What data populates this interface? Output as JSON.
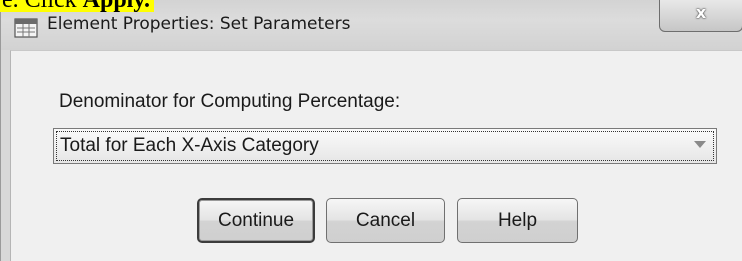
{
  "instruction": {
    "prefix": "e. Click ",
    "emphasis": "Apply."
  },
  "dialog": {
    "title": "Element Properties: Set Parameters",
    "close_label": "x"
  },
  "denominator": {
    "label": "Denominator for Computing Percentage:",
    "selected_value": "Total for Each X-Axis Category"
  },
  "buttons": {
    "continue_label": "Continue",
    "cancel_label": "Cancel",
    "help_label": "Help"
  }
}
